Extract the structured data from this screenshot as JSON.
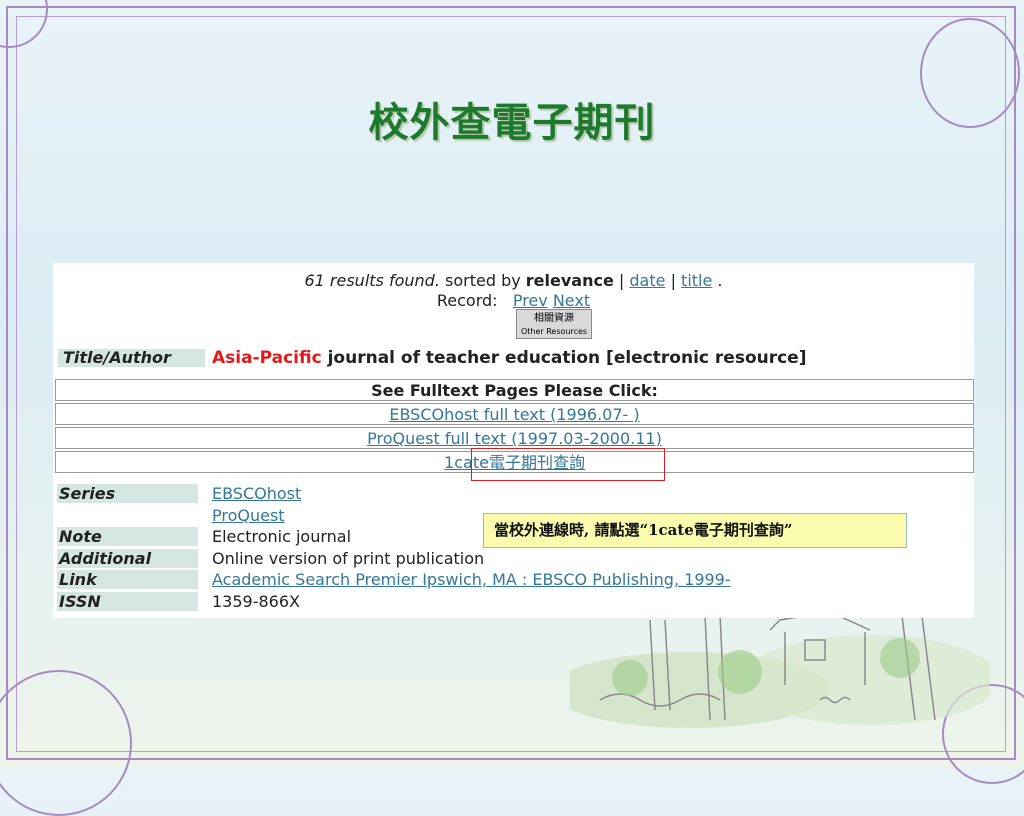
{
  "slide": {
    "title": "校外查電子期刊"
  },
  "results": {
    "count_text": "61 results found.",
    "sorted_by_text": "sorted by",
    "relevance": "relevance",
    "separator1": "|",
    "date_link": "date",
    "separator2": "|",
    "title_link": "title",
    "period": "."
  },
  "record": {
    "label": "Record:",
    "prev": "Prev",
    "next": "Next"
  },
  "other_resources_button": {
    "label_cn": "相關資源",
    "label_en": "Other Resources"
  },
  "title_author": {
    "label": "Title/Author",
    "highlight": "Asia-Pacific",
    "rest": "journal of teacher education [electronic resource]"
  },
  "fulltext": {
    "header": "See Fulltext Pages Please Click:",
    "links": [
      "EBSCOhost full text (1996.07- )",
      "ProQuest full text (1997.03-2000.11)",
      "1cate電子期刊查詢"
    ]
  },
  "meta": [
    {
      "label": "Series",
      "value": "EBSCOhost",
      "link": true
    },
    {
      "label": "",
      "value": "ProQuest",
      "link": true
    },
    {
      "label": "Note",
      "value": "Electronic journal",
      "link": false
    },
    {
      "label": "Additional Form",
      "value": "Online version of print publication",
      "link": false
    },
    {
      "label": "Link",
      "value": "Academic Search Premier Ipswich, MA : EBSCO Publishing, 1999-",
      "link": true
    },
    {
      "label": "ISSN",
      "value": "1359-866X",
      "link": false
    }
  ],
  "callout": {
    "text": "當校外連線時, 請點選“1cate電子期刊查詢”"
  },
  "colors": {
    "title_green": "#1d7a2c",
    "frame_purple": "#a58bc2",
    "link_blue": "#337799",
    "highlight_red": "#e21a1a",
    "callout_yellow": "#fcfcae"
  }
}
